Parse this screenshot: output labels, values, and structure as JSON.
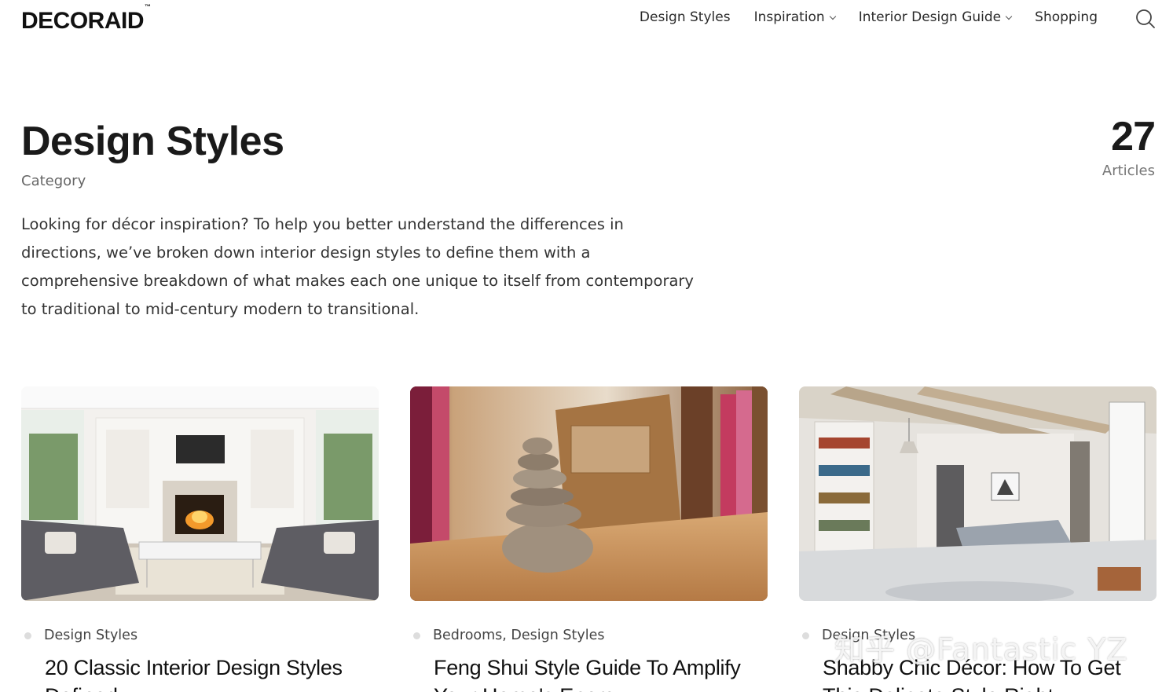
{
  "header": {
    "logo": "DECORAID",
    "logo_mark": "™",
    "nav": [
      {
        "label": "Design Styles",
        "has_dropdown": false
      },
      {
        "label": "Inspiration",
        "has_dropdown": true
      },
      {
        "label": "Interior Design Guide",
        "has_dropdown": true
      },
      {
        "label": "Shopping",
        "has_dropdown": false
      }
    ],
    "search_icon": "search-icon"
  },
  "hero": {
    "title": "Design Styles",
    "subtitle": "Category",
    "count": "27",
    "count_label": "Articles",
    "description": "Looking for décor inspiration? To help you better understand the differences in directions, we’ve broken down interior design styles to define them with a comprehensive breakdown of what makes each one unique to itself from contemporary to traditional to mid-century modern to transitional."
  },
  "cards": [
    {
      "category": "Design Styles",
      "title": "20 Classic Interior Design Styles",
      "title_line2": "Defined"
    },
    {
      "category": "Bedrooms, Design Styles",
      "title": "Feng Shui Style Guide To Amplify",
      "title_line2": "Your Home's Energy"
    },
    {
      "category": "Design Styles",
      "title": "Shabby Chic Décor: How To Get",
      "title_line2": "This Delicate Style Right"
    }
  ],
  "watermark": "知乎 @Fantastic YZ",
  "colors": {
    "text": "#1a1a1a",
    "muted": "#666666",
    "dot": "#dddddd"
  }
}
